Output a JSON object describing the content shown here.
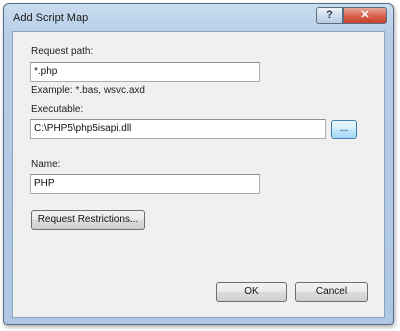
{
  "window": {
    "title": "Add Script Map",
    "help_glyph": "?",
    "close_glyph": "✕"
  },
  "request_path": {
    "label": "Request path:",
    "value": "*.php",
    "example": "Example: *.bas, wsvc.axd"
  },
  "executable": {
    "label": "Executable:",
    "value": "C:\\PHP5\\php5isapi.dll",
    "browse_label": "..."
  },
  "name": {
    "label": "Name:",
    "value": "PHP"
  },
  "buttons": {
    "restrictions_label": "Request Restrictions...",
    "ok_label": "OK",
    "cancel_label": "Cancel"
  },
  "icons": [
    "help-icon",
    "close-icon"
  ]
}
